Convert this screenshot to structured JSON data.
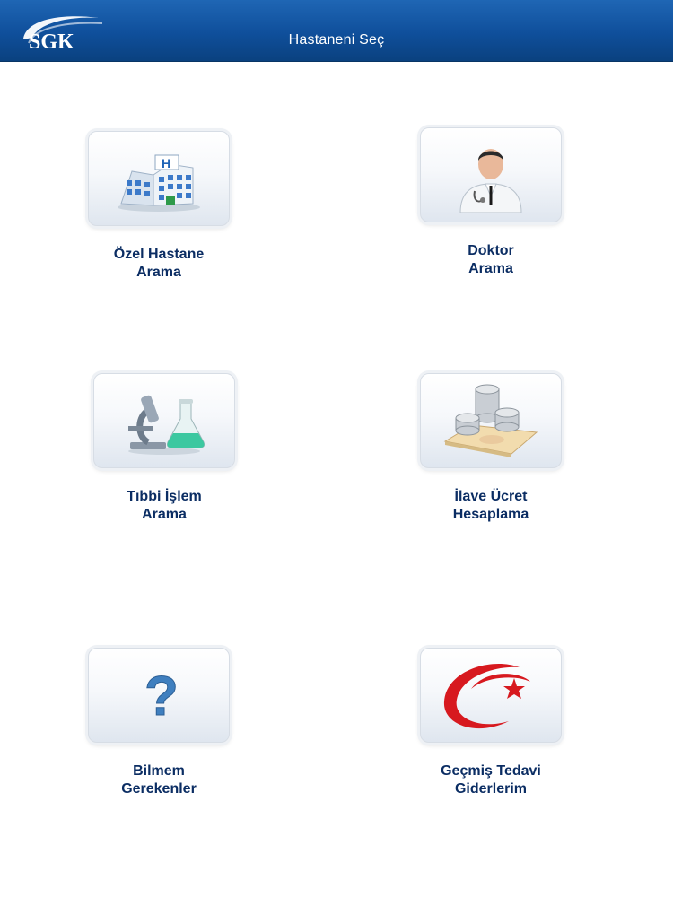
{
  "header": {
    "logo_text": "SGK",
    "title": "Hastaneni Seç"
  },
  "tiles": [
    {
      "icon": "hospital-icon",
      "line1": "Özel Hastane",
      "line2": "Arama"
    },
    {
      "icon": "doctor-icon",
      "line1": "Doktor",
      "line2": "Arama"
    },
    {
      "icon": "microscope-icon",
      "line1": "Tıbbi İşlem",
      "line2": "Arama"
    },
    {
      "icon": "coins-icon",
      "line1": "İlave Ücret",
      "line2": "Hesaplama"
    },
    {
      "icon": "question-mark-icon",
      "line1": "Bilmem",
      "line2": "Gerekenler"
    },
    {
      "icon": "crescent-star-icon",
      "line1": "Geçmiş Tedavi",
      "line2": "Giderlerim"
    }
  ],
  "colors": {
    "header_blue": "#0f4f9b",
    "label_navy": "#0b2d63",
    "crescent_red": "#d7191f",
    "question_blue": "#3f7fbf"
  }
}
